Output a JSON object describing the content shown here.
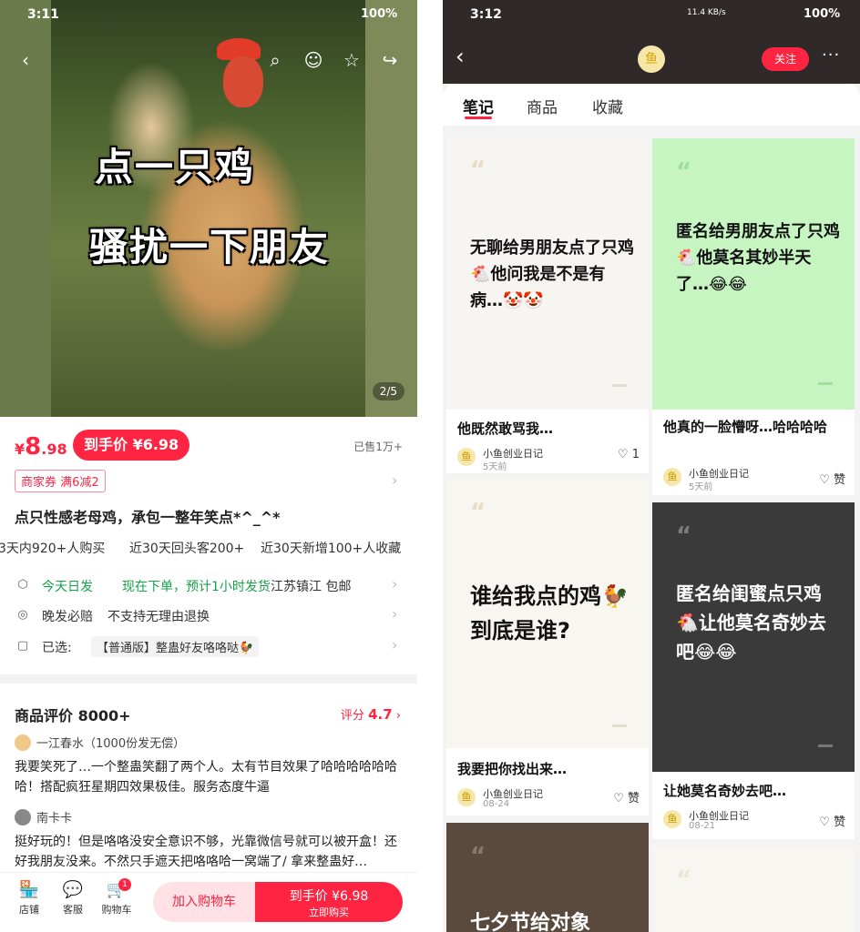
{
  "left": {
    "status": {
      "time": "3:11",
      "battery": "100%"
    },
    "hero": {
      "line1": "点一只鸡",
      "line2": "骚扰一下朋友",
      "counter": "2/5"
    },
    "price": {
      "currency": "¥",
      "integer": "8",
      "decimal": ".98",
      "btn": "到手价 ¥6.98",
      "sold": "已售1万+"
    },
    "coupon": "商家券 满6减2",
    "title": "点只性感老母鸡，承包一整年笑点*^_^*",
    "stats": [
      "3天内920+人购买",
      "近30天回头客200+",
      "近30天新增100+人收藏"
    ],
    "shipping": {
      "today": "今天日发",
      "notice": "现在下单，预计1小时发货",
      "location": "江苏镇江 包邮"
    },
    "guarantee": {
      "a": "晚发必赔",
      "b": "不支持无理由退换"
    },
    "selected": {
      "label": "已选:",
      "value": "【普通版】整蛊好友咯咯哒🐓"
    },
    "reviews": {
      "heading": "商品评价 8000+",
      "score_label": "评分",
      "score": "4.7",
      "items": [
        {
          "user": "一江春水（1000份发无偿）",
          "text": "我要笑死了…一个整蛊笑翻了两个人。太有节目效果了哈哈哈哈哈哈哈！搭配疯狂星期四效果极佳。服务态度牛逼"
        },
        {
          "user": "南卡卡",
          "text": "挺好玩的！但是咯咯没安全意识不够，光靠微信号就可以被开盒！还好我朋友没来。不然只手遮天把咯咯哈一窝端了/ 拿来整蛊好…"
        }
      ]
    },
    "bottom": {
      "store": "店铺",
      "service": "客服",
      "cart": "购物车",
      "cart_count": "1",
      "add_cart": "加入购物车",
      "buy_price": "到手价 ¥6.98",
      "buy_now": "立即购买"
    }
  },
  "right": {
    "status": {
      "time": "3:12",
      "net": "11.4 KB/s",
      "battery": "100%"
    },
    "follow": "关注",
    "tabs": [
      "笔记",
      "商品",
      "收藏"
    ],
    "author": "小鱼创业日记",
    "cards": [
      {
        "text": "无聊给男朋友点了只鸡🐔他问我是不是有病…🤡🤡",
        "title": "他既然敢骂我…",
        "time": "5天前",
        "likes": "1"
      },
      {
        "text": "匿名给男朋友点了只鸡🐔他莫名其妙半天了…😂😂",
        "title": "他真的一脸懵呀…哈哈哈哈",
        "time": "5天前",
        "likes": "赞"
      },
      {
        "text": "谁给我点的鸡🐓到底是谁?",
        "title": "我要把你找出来…",
        "time": "08-24",
        "likes": "赞"
      },
      {
        "text": "匿名给闺蜜点只鸡🐔让他莫名奇妙去吧😂😂",
        "title": "让她莫名奇妙去吧…",
        "time": "08-21",
        "likes": "赞"
      },
      {
        "text": "七夕节给对象",
        "title": "",
        "time": "",
        "likes": ""
      }
    ],
    "colors": {
      "accent": "#ff2442",
      "header": "#2f2a29",
      "card_green": "#c6f5c2",
      "card_dark": "#3a3a3a",
      "card_brown": "#5a4a3e"
    }
  }
}
